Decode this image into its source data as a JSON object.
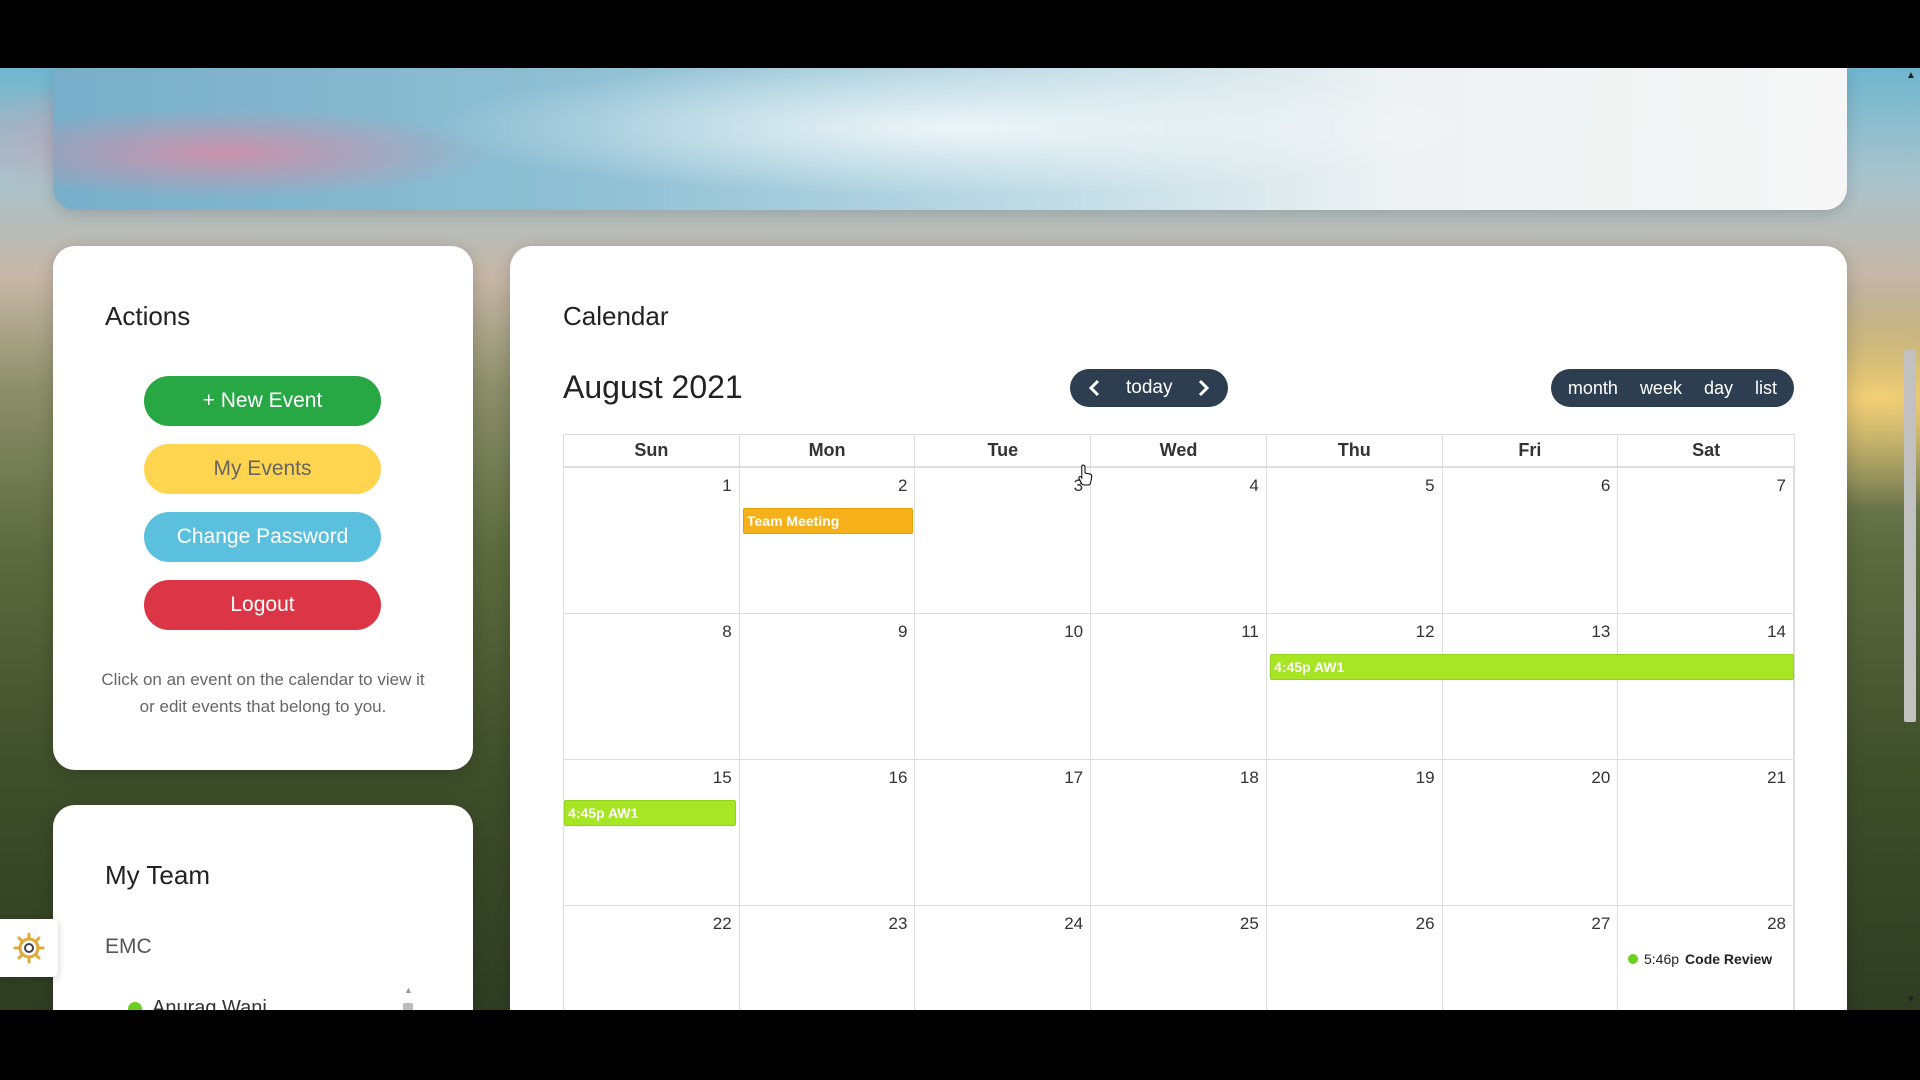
{
  "actions": {
    "title": "Actions",
    "new_event": "+ New Event",
    "my_events": "My Events",
    "change_password": "Change Password",
    "logout": "Logout",
    "hint": "Click on an event on the calendar to view it or edit events that belong to you."
  },
  "team": {
    "title": "My Team",
    "name": "EMC",
    "member": "Anurag Wani"
  },
  "calendar": {
    "title": "Calendar",
    "month_title": "August 2021",
    "today_label": "today",
    "views": [
      "month",
      "week",
      "day",
      "list"
    ],
    "weekdays": [
      "Sun",
      "Mon",
      "Tue",
      "Wed",
      "Thu",
      "Fri",
      "Sat"
    ],
    "weeks": [
      [
        "1",
        "2",
        "3",
        "4",
        "5",
        "6",
        "7"
      ],
      [
        "8",
        "9",
        "10",
        "11",
        "12",
        "13",
        "14"
      ],
      [
        "15",
        "16",
        "17",
        "18",
        "19",
        "20",
        "21"
      ],
      [
        "22",
        "23",
        "24",
        "25",
        "26",
        "27",
        "28"
      ]
    ],
    "events": {
      "team_meeting": "Team Meeting",
      "aw1_a": "4:45p AW1",
      "aw1_b": "4:45p AW1",
      "code_review_time": "5:46p",
      "code_review_name": "Code Review"
    }
  },
  "colors": {
    "primary_green": "#28a745",
    "warning_yellow": "#ffd54f",
    "info_blue": "#5bc0de",
    "danger_red": "#dc3545",
    "toolbar_dark": "#2c3e50",
    "event_orange": "#f6b01a",
    "event_green": "#a7e625"
  },
  "icons": {
    "prev": "chevron-left-icon",
    "next": "chevron-right-icon",
    "settings": "gear-icon"
  }
}
